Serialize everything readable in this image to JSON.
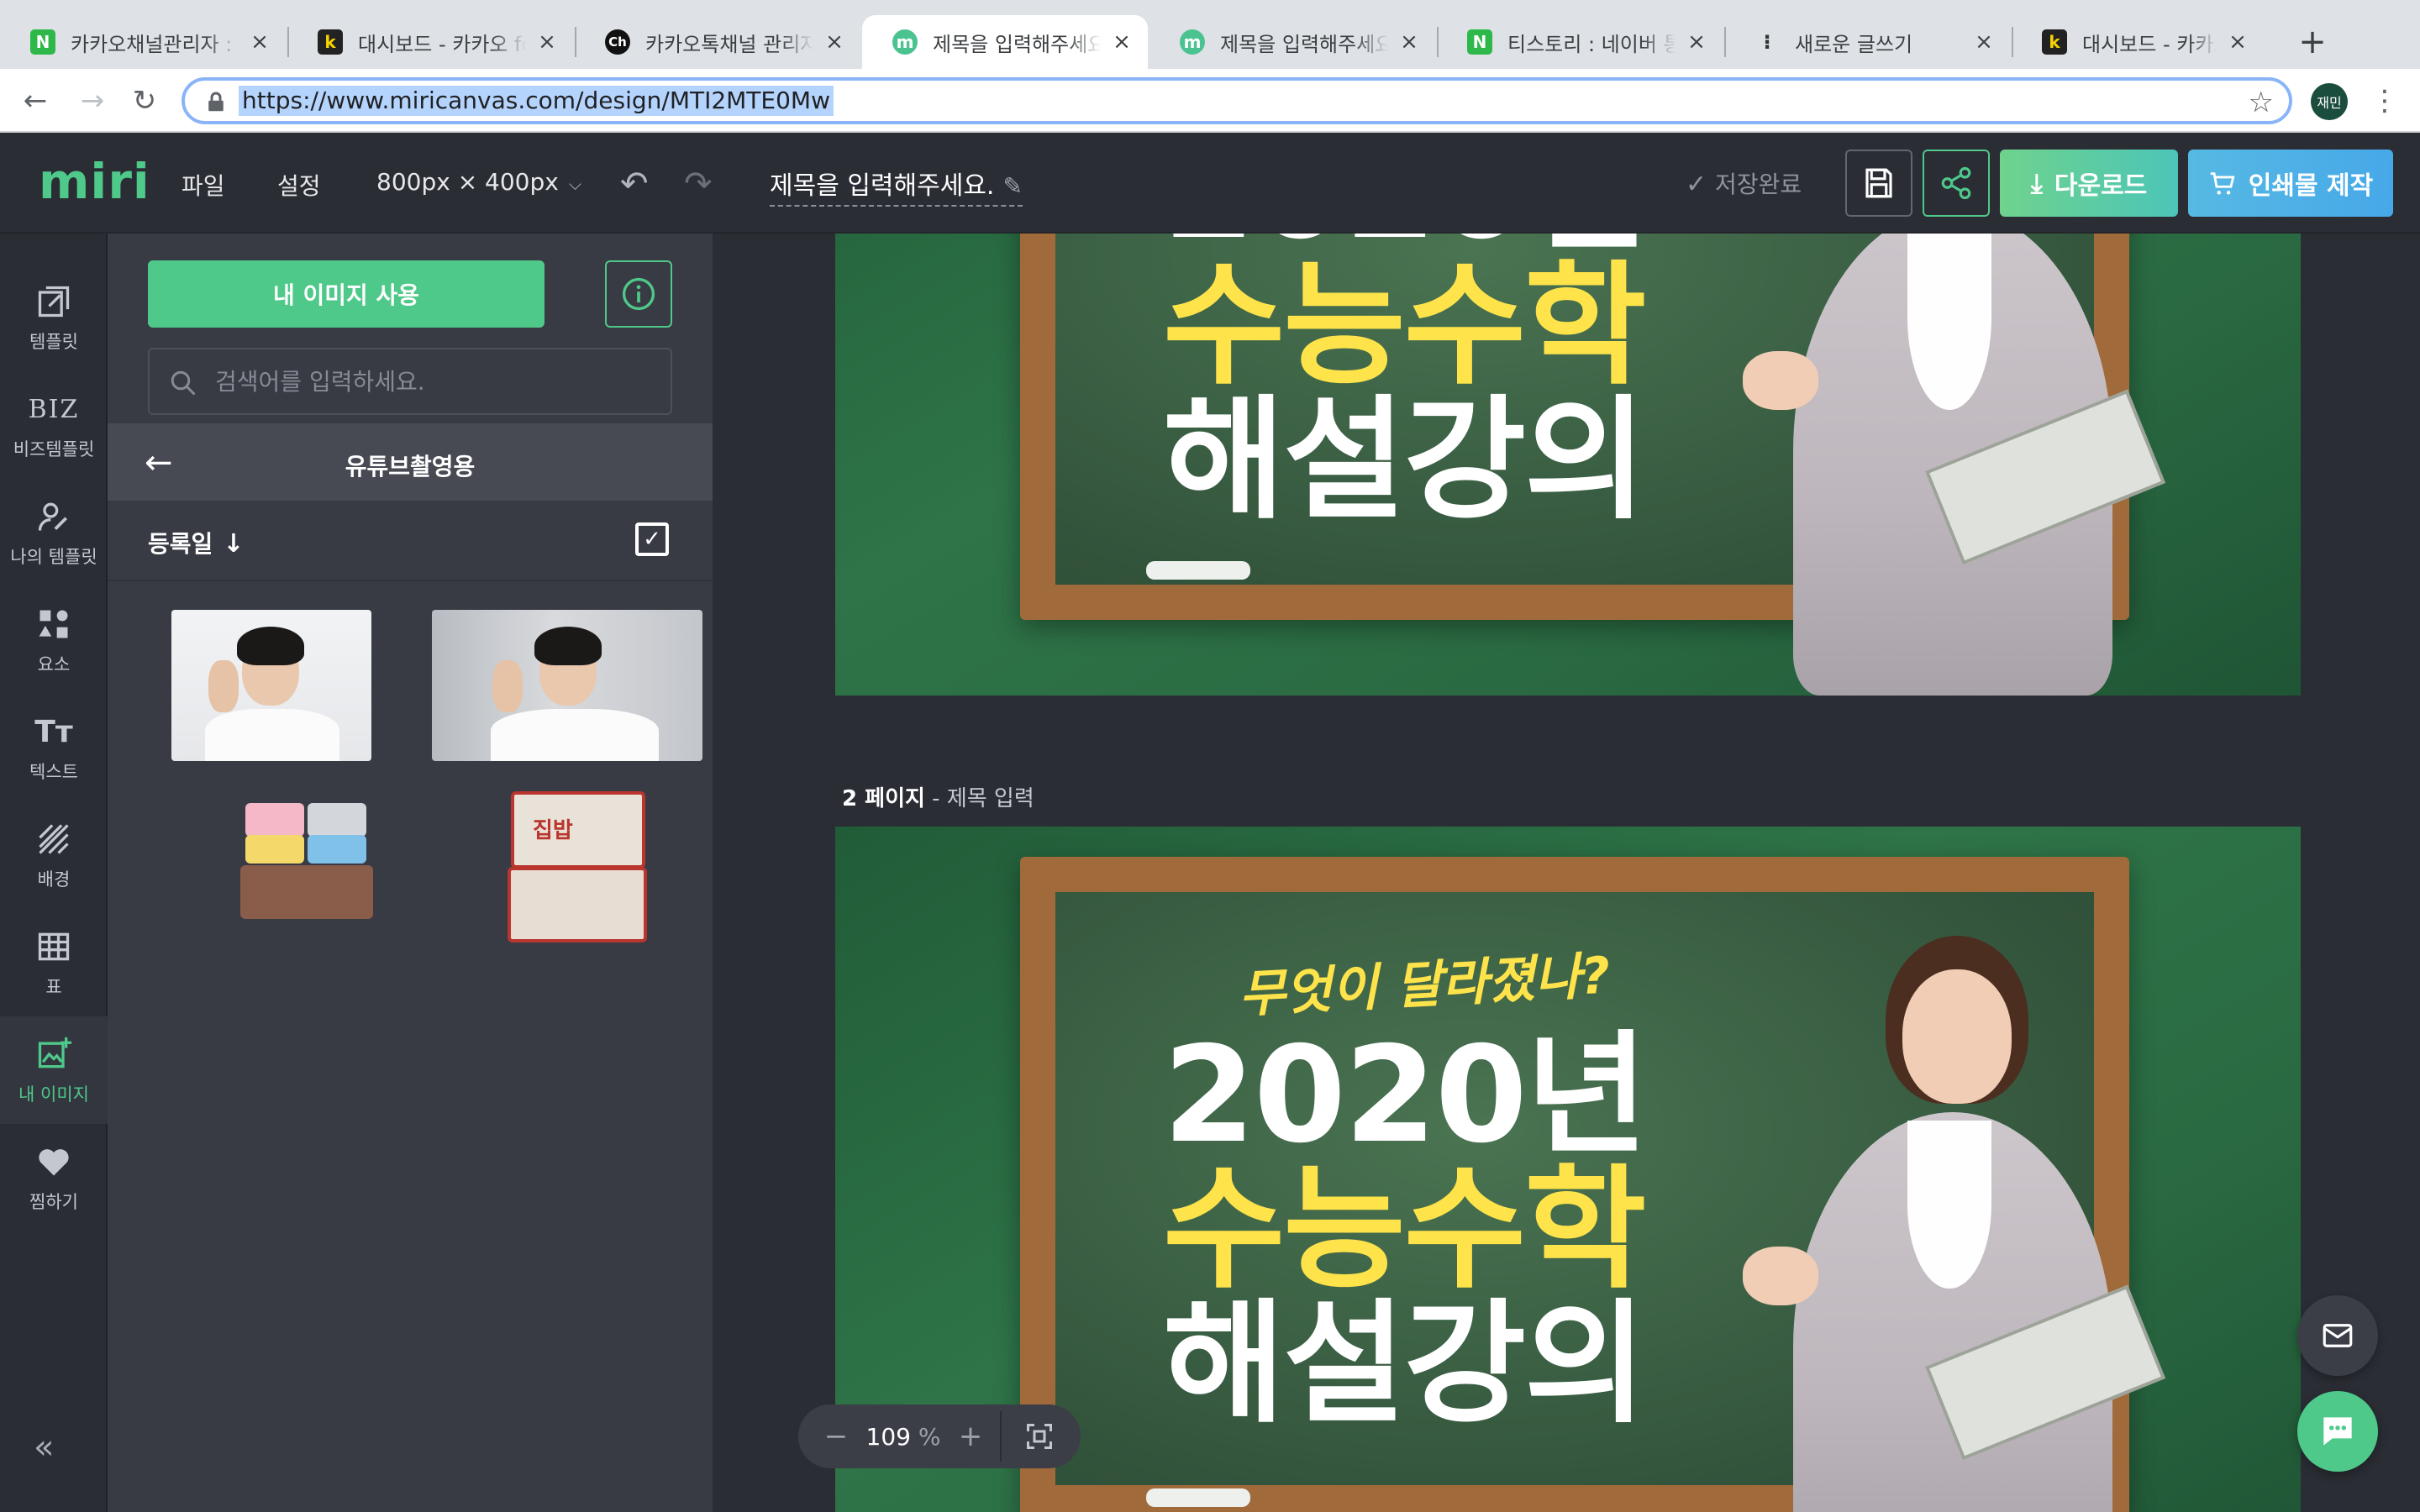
{
  "browser": {
    "tabs": [
      {
        "title": "카카오채널관리자 : 네",
        "favicon": "N",
        "type": "n"
      },
      {
        "title": "대시보드 - 카카오 for",
        "favicon": "k",
        "type": "k"
      },
      {
        "title": "카카오톡채널 관리자센",
        "favicon": "Ch",
        "type": "ch"
      },
      {
        "title": "제목을 입력해주세요.",
        "favicon": "m",
        "type": "m",
        "active": true
      },
      {
        "title": "제목을 입력해주세요.",
        "favicon": "m",
        "type": "m"
      },
      {
        "title": "티스토리 : 네이버 통합",
        "favicon": "N",
        "type": "n"
      },
      {
        "title": "새로운 글쓰기",
        "favicon": "⁝",
        "type": "t"
      },
      {
        "title": "대시보드 - 카카오 for",
        "favicon": "k",
        "type": "k"
      }
    ],
    "new_tab": "+",
    "url": "https://www.miricanvas.com/design/MTI2MTE0Mw",
    "profile": "재민"
  },
  "app": {
    "logo": "miri",
    "menu_file": "파일",
    "menu_settings": "설정",
    "canvas_size": "800px × 400px",
    "doc_title": "제목을 입력해주세요.",
    "save_status": "저장완료",
    "download": "다운로드",
    "print": "인쇄물 제작"
  },
  "rail": {
    "items": [
      {
        "label": "템플릿",
        "icon": "template-icon"
      },
      {
        "label": "비즈템플릿",
        "icon": "biz-icon"
      },
      {
        "label": "나의 템플릿",
        "icon": "my-template-icon"
      },
      {
        "label": "요소",
        "icon": "elements-icon"
      },
      {
        "label": "텍스트",
        "icon": "text-icon"
      },
      {
        "label": "배경",
        "icon": "background-icon"
      },
      {
        "label": "표",
        "icon": "table-icon"
      },
      {
        "label": "내 이미지",
        "icon": "my-image-icon",
        "active": true
      },
      {
        "label": "찜하기",
        "icon": "heart-icon"
      }
    ],
    "biz_glyph": "BIZ",
    "text_glyph": "Tт",
    "collapse": "«"
  },
  "panel": {
    "use_image": "내 이미지 사용",
    "search_placeholder": "검색어를 입력하세요.",
    "folder_title": "유튜브촬영용",
    "sort_label": "등록일",
    "sort_arrow": "↓",
    "box_label": "집밥"
  },
  "canvas": {
    "page2_label_bold": "2 페이지",
    "page2_label_rest": " - 제목 입력",
    "headline_year": "2020년",
    "headline_subject": "수능수학",
    "headline_course": "해설강의",
    "subtitle": "무엇이 달라졌나?",
    "zoom_value": "109",
    "zoom_unit": " %"
  },
  "colors": {
    "brand_green": "#4ec98a",
    "print_blue": "#47a8e8",
    "headline_yellow": "#ffe34a",
    "chalkboard": "#34563d"
  }
}
